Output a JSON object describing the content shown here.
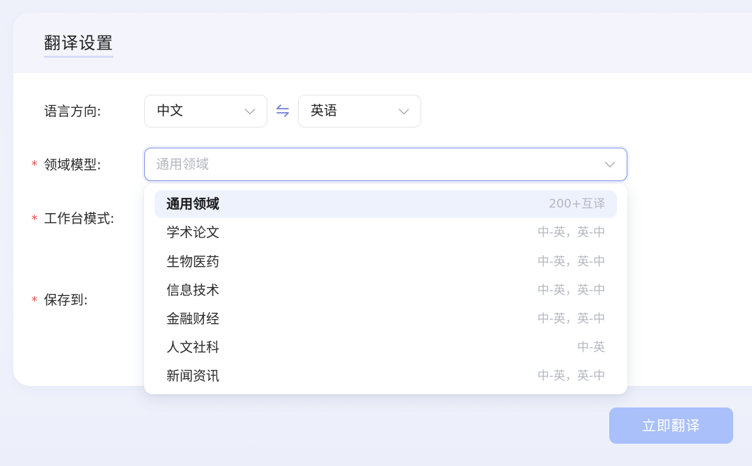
{
  "settings": {
    "title": "翻译设置",
    "labels": {
      "language_direction": "语言方向:",
      "domain_model": "领域模型:",
      "workbench_mode": "工作台模式:",
      "save_to": "保存到:"
    },
    "required_mark": "*",
    "source_language": "中文",
    "target_language": "英语",
    "domain_placeholder": "通用领域"
  },
  "dropdown": {
    "options": [
      {
        "name": "通用领域",
        "pairs": "200+互译",
        "selected": true
      },
      {
        "name": "学术论文",
        "pairs": "中-英，英-中"
      },
      {
        "name": "生物医药",
        "pairs": "中-英，英-中"
      },
      {
        "name": "信息技术",
        "pairs": "中-英，英-中"
      },
      {
        "name": "金融财经",
        "pairs": "中-英，英-中"
      },
      {
        "name": "人文社科",
        "pairs": "中-英"
      },
      {
        "name": "新闻资讯",
        "pairs": "中-英，英-中"
      }
    ]
  },
  "actions": {
    "translate_label": "立即翻译"
  },
  "icons": {
    "select_arrow": "chevron-down-icon",
    "swap": "swap-arrows-icon"
  },
  "colors": {
    "accent": "#7d93ea",
    "button": "#a9c0fb",
    "required": "#e0574a",
    "selected_option_bg": "#eef2fd"
  }
}
